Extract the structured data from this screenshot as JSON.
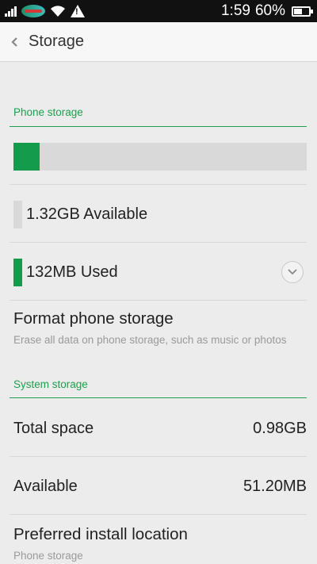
{
  "status_bar": {
    "time": "1:59",
    "battery_percent": "60%",
    "battery_level": 0.6,
    "icons": [
      "signal-icon",
      "carrier-logo-icon",
      "wifi-icon",
      "warning-icon",
      "battery-icon"
    ]
  },
  "header": {
    "back_icon": "chevron-left-icon",
    "title": "Storage"
  },
  "phone_storage": {
    "section_title": "Phone storage",
    "used_fraction": 0.09,
    "available_label": "1.32GB Available",
    "used_label": "132MB Used",
    "expand_icon": "chevron-down-icon",
    "colors": {
      "used": "#149c4c",
      "available": "#d9d9d9",
      "accent": "#1ca04c"
    }
  },
  "format": {
    "title": "Format phone storage",
    "subtitle": "Erase all data on phone storage, such as music or photos"
  },
  "system_storage": {
    "section_title": "System storage",
    "rows": [
      {
        "label": "Total space",
        "value": "0.98GB"
      },
      {
        "label": "Available",
        "value": "51.20MB"
      }
    ]
  },
  "install_location": {
    "title": "Preferred install location",
    "value": "Phone storage"
  }
}
